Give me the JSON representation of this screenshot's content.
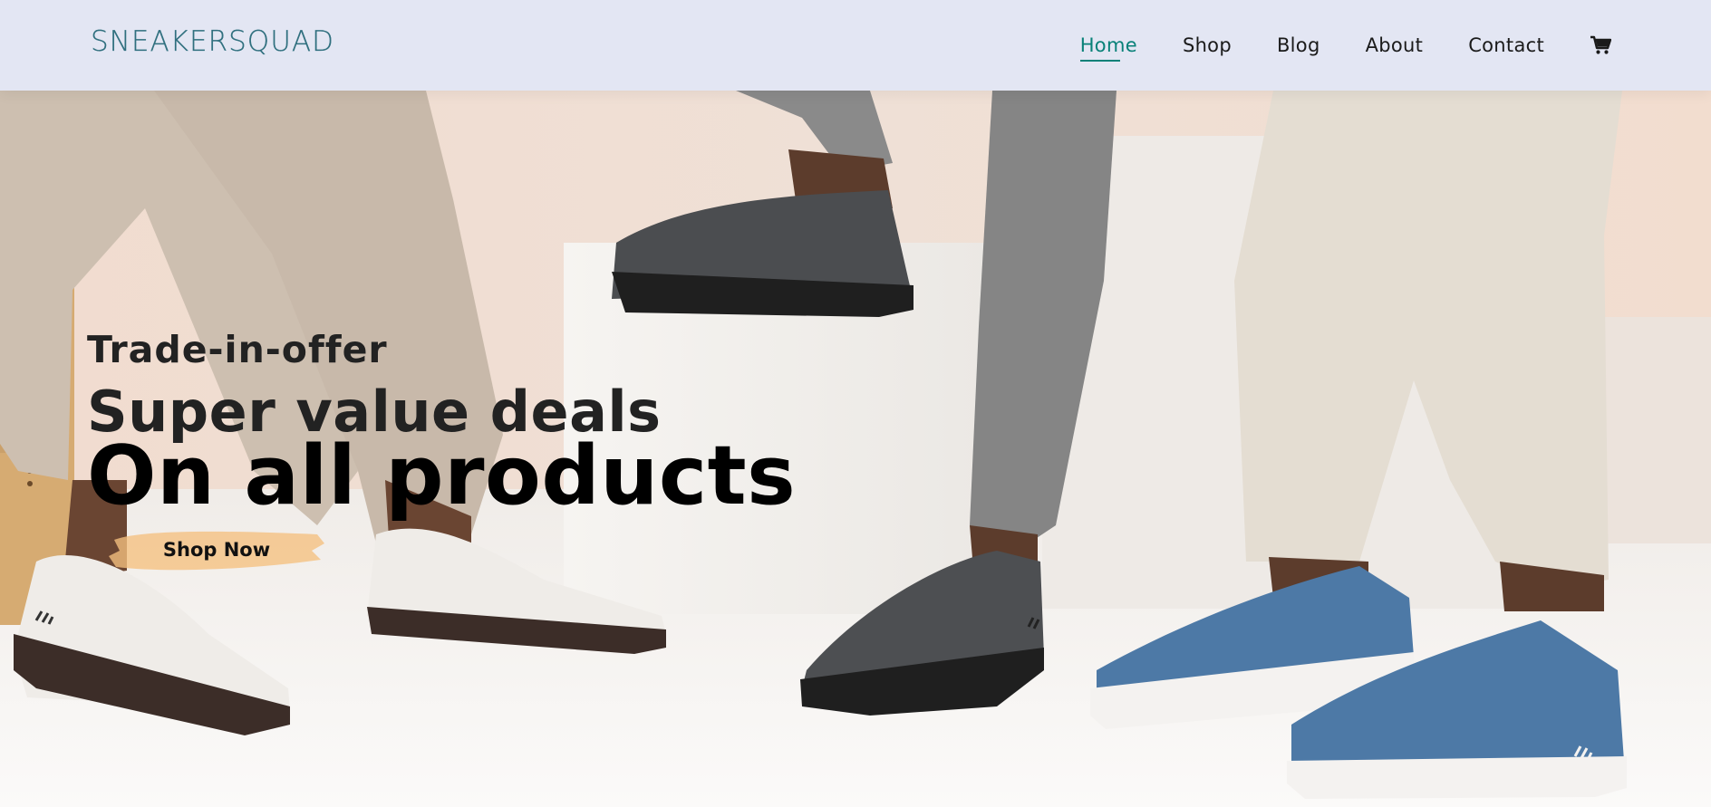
{
  "header": {
    "logo": "SNEAKERSQUAD",
    "nav": [
      {
        "label": "Home",
        "active": true
      },
      {
        "label": "Shop",
        "active": false
      },
      {
        "label": "Blog",
        "active": false
      },
      {
        "label": "About",
        "active": false
      },
      {
        "label": "Contact",
        "active": false
      }
    ],
    "cart_icon": "cart-icon"
  },
  "hero": {
    "subtitle": "Trade-in-offer",
    "title": "Super value deals",
    "title2": "On all products",
    "cta_label": "Shop Now"
  },
  "colors": {
    "header_bg": "#e3e6f3",
    "accent": "#088178",
    "logo": "#2f6f7e",
    "button_brush": "#f5c07f"
  }
}
